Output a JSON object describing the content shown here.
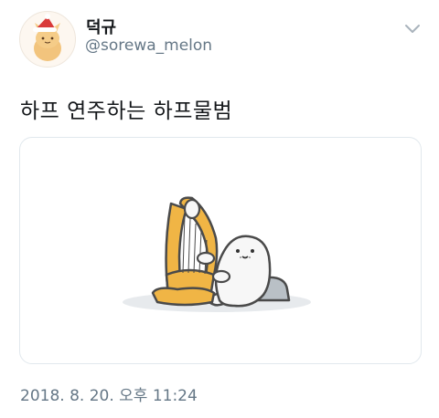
{
  "tweet": {
    "display_name": "덕규",
    "handle": "@sorewa_melon",
    "text": "하프 연주하는 하프물범",
    "timestamp": "2018. 8. 20. 오후 11:24"
  },
  "icons": {
    "avatar": "cat-with-santa-hat-avatar",
    "menu": "chevron-down-icon"
  },
  "media": {
    "subject": "seal-playing-harp-illustration"
  },
  "colors": {
    "text_primary": "#14171a",
    "text_secondary": "#657786",
    "border": "#e1e8ed",
    "harp_gold": "#f0b545",
    "seal_white": "#f7f7f7"
  }
}
